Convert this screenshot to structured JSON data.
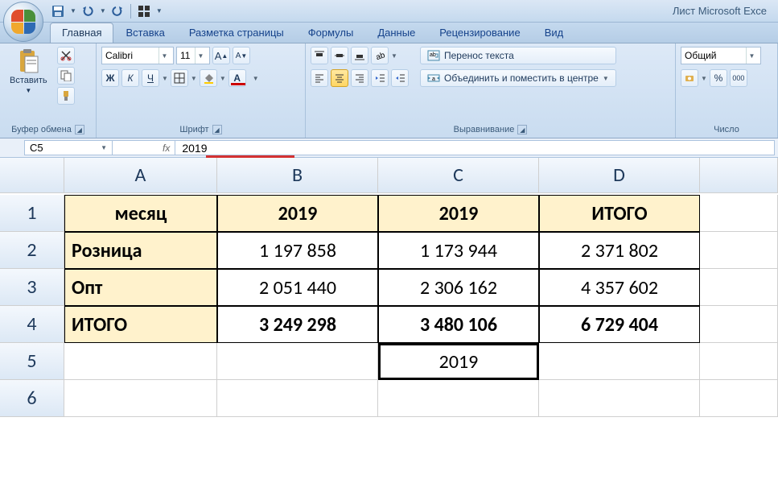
{
  "app": {
    "title": "Лист Microsoft Exce"
  },
  "qat": {
    "save": "save-icon",
    "undo": "undo-icon",
    "redo": "redo-icon",
    "grid": "grid-icon"
  },
  "tabs": [
    {
      "label": "Главная",
      "active": true
    },
    {
      "label": "Вставка",
      "active": false
    },
    {
      "label": "Разметка страницы",
      "active": false
    },
    {
      "label": "Формулы",
      "active": false
    },
    {
      "label": "Данные",
      "active": false
    },
    {
      "label": "Рецензирование",
      "active": false
    },
    {
      "label": "Вид",
      "active": false
    }
  ],
  "ribbon": {
    "clipboard": {
      "title": "Буфер обмена",
      "paste_label": "Вставить"
    },
    "font": {
      "title": "Шрифт",
      "name": "Calibri",
      "size": "11",
      "bold": "Ж",
      "italic": "К",
      "underline": "Ч"
    },
    "alignment": {
      "title": "Выравнивание",
      "wrap_label": "Перенос текста",
      "merge_label": "Объединить и поместить в центре"
    },
    "number": {
      "title": "Число",
      "format": "Общий",
      "percent": "%",
      "comma": "000"
    }
  },
  "formula_bar": {
    "cell_ref": "C5",
    "fx": "fx",
    "value": "2019"
  },
  "sheet": {
    "columns": [
      "A",
      "B",
      "C",
      "D"
    ],
    "rows": [
      "1",
      "2",
      "3",
      "4",
      "5",
      "6"
    ],
    "headers": {
      "a1": "месяц",
      "b1": "2019",
      "c1": "2019",
      "d1": "ИТОГО"
    },
    "data": [
      {
        "label": "Розница",
        "b": "1 197 858",
        "c": "1 173 944",
        "d": "2 371 802"
      },
      {
        "label": "Опт",
        "b": "2 051 440",
        "c": "2 306 162",
        "d": "4 357 602"
      },
      {
        "label": "ИТОГО",
        "b": "3 249 298",
        "c": "3 480 106",
        "d": "6 729 404",
        "bold": true
      }
    ],
    "active": {
      "ref": "C5",
      "value": "2019"
    }
  },
  "chart_data": {
    "type": "table",
    "title": "",
    "columns": [
      "месяц",
      "2019",
      "2019",
      "ИТОГО"
    ],
    "rows": [
      [
        "Розница",
        1197858,
        1173944,
        2371802
      ],
      [
        "Опт",
        2051440,
        2306162,
        4357602
      ],
      [
        "ИТОГО",
        3249298,
        3480106,
        6729404
      ]
    ]
  }
}
